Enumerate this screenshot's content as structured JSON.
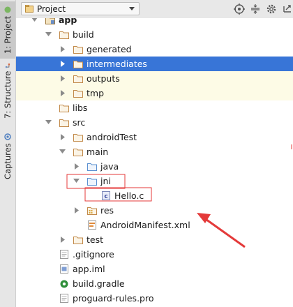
{
  "side_tabs": {
    "project": "1: Project",
    "structure": "7: Structure",
    "captures": "Captures"
  },
  "header": {
    "view_label": "Project",
    "icons": [
      "target-icon",
      "collapse-all-icon",
      "settings-icon",
      "hide-icon"
    ]
  },
  "tree": {
    "rows": [
      {
        "id": "app",
        "label": "app",
        "level": 0,
        "icon": "module-folder",
        "expanded": true,
        "bold": true
      },
      {
        "id": "build",
        "label": "build",
        "level": 1,
        "icon": "folder",
        "expanded": true
      },
      {
        "id": "generated",
        "label": "generated",
        "level": 2,
        "icon": "folder",
        "expanded": false
      },
      {
        "id": "intermediates",
        "label": "intermediates",
        "level": 2,
        "icon": "folder",
        "expanded": false,
        "selected": true
      },
      {
        "id": "outputs",
        "label": "outputs",
        "level": 2,
        "icon": "folder",
        "expanded": false,
        "ignored": true
      },
      {
        "id": "tmp",
        "label": "tmp",
        "level": 2,
        "icon": "folder",
        "expanded": false,
        "ignored": true
      },
      {
        "id": "libs",
        "label": "libs",
        "level": 1,
        "icon": "folder",
        "leaf": true
      },
      {
        "id": "src",
        "label": "src",
        "level": 1,
        "icon": "folder",
        "expanded": true
      },
      {
        "id": "androidTest",
        "label": "androidTest",
        "level": 2,
        "icon": "folder",
        "expanded": false
      },
      {
        "id": "main",
        "label": "main",
        "level": 2,
        "icon": "folder",
        "expanded": true
      },
      {
        "id": "java",
        "label": "java",
        "level": 3,
        "icon": "source-folder",
        "expanded": false
      },
      {
        "id": "jni",
        "label": "jni",
        "level": 3,
        "icon": "source-folder",
        "expanded": true
      },
      {
        "id": "hello_c",
        "label": "Hello.c",
        "level": 4,
        "icon": "c-file",
        "leaf": true
      },
      {
        "id": "res",
        "label": "res",
        "level": 3,
        "icon": "res-folder",
        "expanded": false
      },
      {
        "id": "manifest",
        "label": "AndroidManifest.xml",
        "level": 3,
        "icon": "xml-file",
        "leaf": true
      },
      {
        "id": "test",
        "label": "test",
        "level": 2,
        "icon": "folder",
        "expanded": false
      },
      {
        "id": "gitignore",
        "label": ".gitignore",
        "level": 1,
        "icon": "text-file",
        "leaf": true
      },
      {
        "id": "app_iml",
        "label": "app.iml",
        "level": 1,
        "icon": "iml-file",
        "leaf": true
      },
      {
        "id": "build_gradle",
        "label": "build.gradle",
        "level": 1,
        "icon": "gradle-file",
        "leaf": true
      },
      {
        "id": "proguard",
        "label": "proguard-rules.pro",
        "level": 1,
        "icon": "text-file",
        "leaf": true
      }
    ]
  },
  "colors": {
    "selection": "#3875d7",
    "ignored_row": "#fdfbe6",
    "folder_outline": "#c28a4a",
    "source_folder": "#5a8fd0",
    "annotation": "#e43a3a"
  }
}
